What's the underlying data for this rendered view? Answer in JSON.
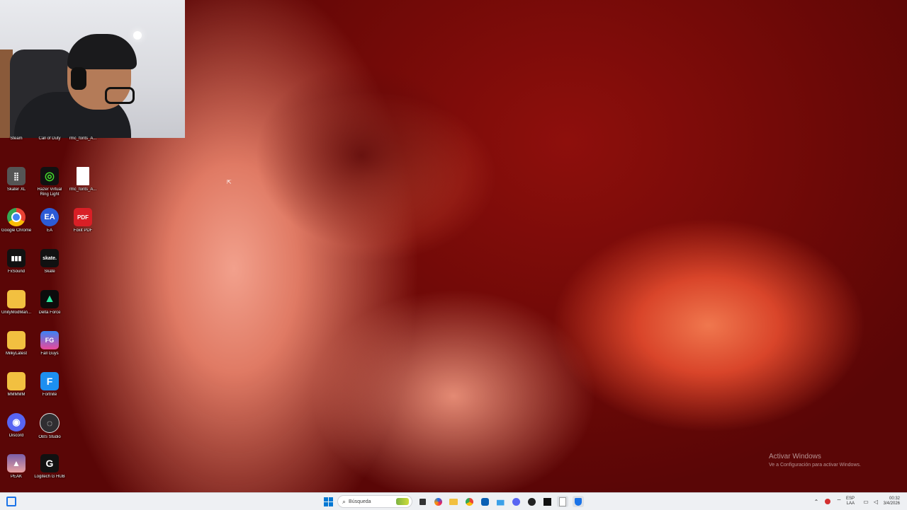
{
  "desktop": {
    "icons": [
      {
        "label": "Steam",
        "color": "#1b2838",
        "glyph": ""
      },
      {
        "label": "Call of Duty",
        "color": "#222222",
        "glyph": ""
      },
      {
        "label": "rmc_fonts_A...",
        "color": "#444444",
        "glyph": ""
      },
      {
        "label": "Skater XL",
        "color": "#555555",
        "glyph": "⣿"
      },
      {
        "label": "Razer Virtual Ring Light",
        "color": "#111111",
        "glyph": "◎"
      },
      {
        "label": "rmc_fonts_A...",
        "color": "#ffffff",
        "glyph": ""
      },
      {
        "label": "Google Chrome",
        "color": "#2a73e8",
        "glyph": "●"
      },
      {
        "label": "EA",
        "color": "#2c5bd6",
        "glyph": "EA"
      },
      {
        "label": "Foxit PDF",
        "color": "#d91f26",
        "glyph": "PDF"
      },
      {
        "label": "FxSound",
        "color": "#111111",
        "glyph": "▮▮▮"
      },
      {
        "label": "Skate",
        "color": "#111111",
        "glyph": "skate."
      },
      {
        "label": "UnityModMan...",
        "color": "#f2c040",
        "glyph": ""
      },
      {
        "label": "Delta Force",
        "color": "#0c0c0c",
        "glyph": "▲"
      },
      {
        "label": "MilkyLatest",
        "color": "#f2c040",
        "glyph": ""
      },
      {
        "label": "Fall Guys",
        "color": "#3b82f6",
        "glyph": "FG"
      },
      {
        "label": "MMMMM",
        "color": "#f2c040",
        "glyph": ""
      },
      {
        "label": "Fortnite",
        "color": "#1d8ff0",
        "glyph": "F"
      },
      {
        "label": "Discord",
        "color": "#5865f2",
        "glyph": "◉"
      },
      {
        "label": "OBS Studio",
        "color": "#302e31",
        "glyph": "◌"
      },
      {
        "label": "PEAK",
        "color": "#7a5fa8",
        "glyph": "▲"
      },
      {
        "label": "Logitech G HUB",
        "color": "#111111",
        "glyph": "G"
      }
    ]
  },
  "watermark": {
    "title": "Activar Windows",
    "subtitle": "Ve a Configuración para activar Windows."
  },
  "taskbar": {
    "search_placeholder": "Búsqueda",
    "lang_line1": "ESP",
    "lang_line2": "LAA",
    "time": "00:32",
    "date": "3/4/2026",
    "apps": [
      "widgets-icon",
      "start-icon",
      "search-icon",
      "task-view-icon",
      "copilot-icon",
      "file-explorer-icon",
      "chrome-icon",
      "edge-icon",
      "store-icon",
      "snipping-icon",
      "discord-icon",
      "steam-icon",
      "fxsound-icon",
      "notepad-icon",
      "shield-icon"
    ]
  }
}
